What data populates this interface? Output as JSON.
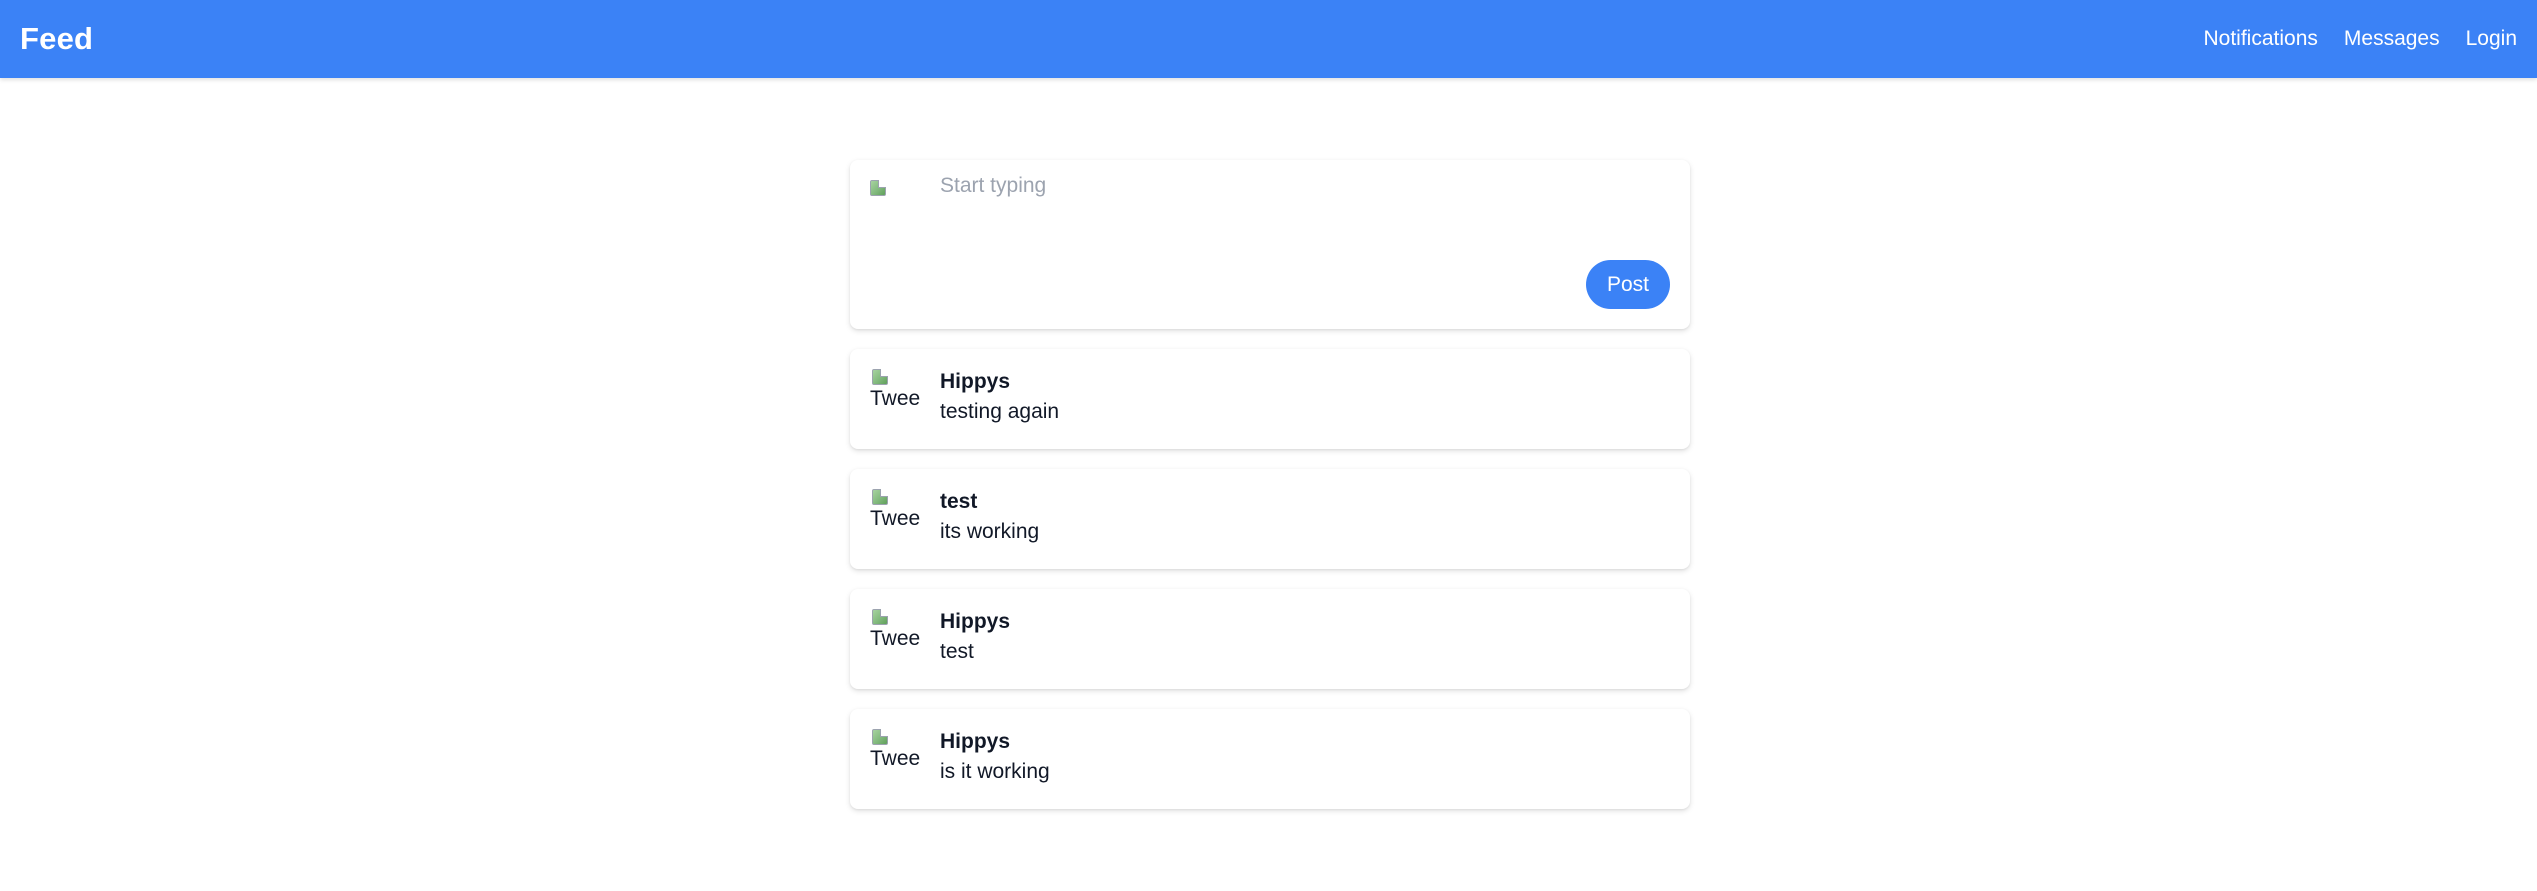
{
  "header": {
    "title": "Feed",
    "nav": [
      {
        "label": "Notifications"
      },
      {
        "label": "Messages"
      },
      {
        "label": "Login"
      }
    ]
  },
  "composer": {
    "placeholder": "Start typing",
    "post_label": "Post"
  },
  "tweets": [
    {
      "author": "Hippys",
      "text": "testing again",
      "avatar_alt": "Twee"
    },
    {
      "author": "test",
      "text": "its working",
      "avatar_alt": "Twee"
    },
    {
      "author": "Hippys",
      "text": "test",
      "avatar_alt": "Twee"
    },
    {
      "author": "Hippys",
      "text": "is it working",
      "avatar_alt": "Twee"
    }
  ],
  "colors": {
    "accent": "#3b82f6",
    "placeholder": "#9ca3af",
    "text": "#111827"
  }
}
